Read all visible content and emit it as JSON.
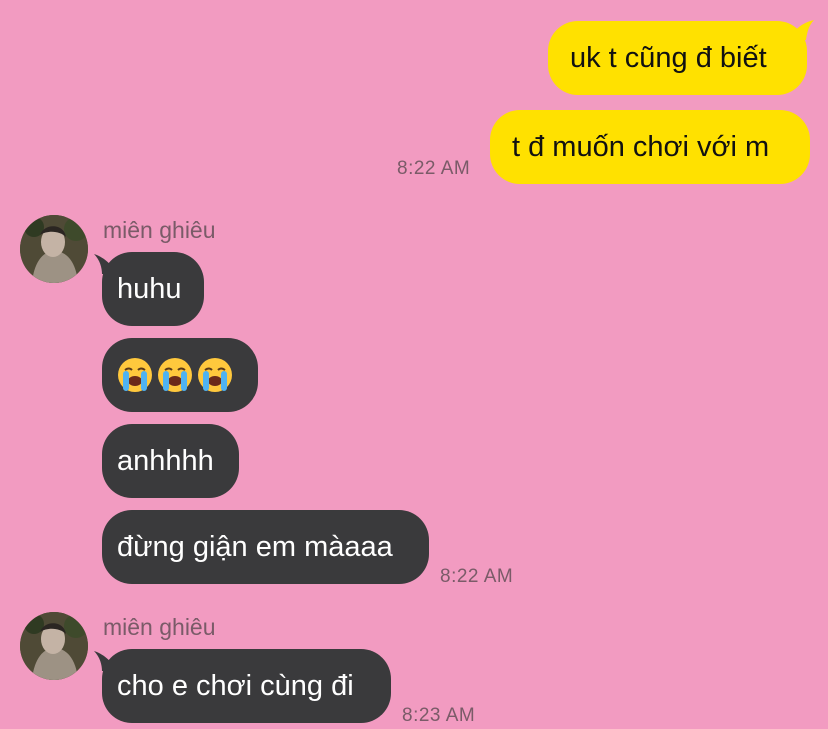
{
  "messages_out": [
    {
      "text": "uk t cũng đ biết"
    },
    {
      "text": "t đ muốn chơi với m"
    }
  ],
  "group_out_time": "8:22 AM",
  "group1": {
    "sender": "miên ghiêu",
    "messages": [
      "huhu",
      "",
      "anhhhh",
      "đừng giận em màaaa"
    ],
    "emoji_names": [
      "loudly-crying-face",
      "loudly-crying-face",
      "loudly-crying-face"
    ],
    "time": "8:22 AM"
  },
  "group2": {
    "sender": "miên ghiêu",
    "messages": [
      "cho e chơi cùng đi"
    ],
    "time": "8:23 AM"
  },
  "colors": {
    "background": "#f29bc1",
    "outgoing_bubble": "#ffe100",
    "incoming_bubble": "#3a3a3c",
    "timestamp": "#7a5b68"
  }
}
